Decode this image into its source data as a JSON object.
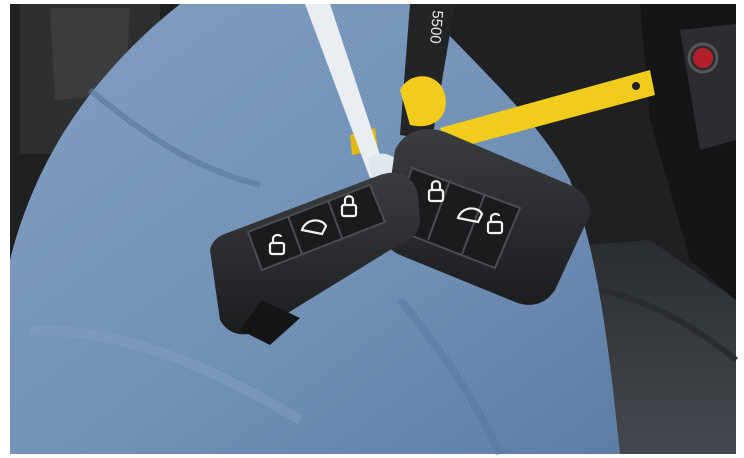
{
  "photo": {
    "subject": "two-car-key-fobs-on-lap",
    "tag_strip_text": "5500",
    "colors": {
      "denim": "#6f8fb5",
      "denim_dark": "#4f6d92",
      "key_body": "#2a2c2e",
      "key_button": "#1c1d1f",
      "cable_tie": "#e9eef2",
      "yellow_tag": "#f2cc1c",
      "car_interior": "#1f2022",
      "seat": "#3c3f44"
    },
    "keys": [
      {
        "name": "front-key",
        "buttons": [
          "unlock-icon",
          "trunk-icon",
          "lock-icon"
        ]
      },
      {
        "name": "back-key",
        "buttons": [
          "lock-icon",
          "trunk-icon",
          "unlock-icon"
        ]
      }
    ]
  }
}
